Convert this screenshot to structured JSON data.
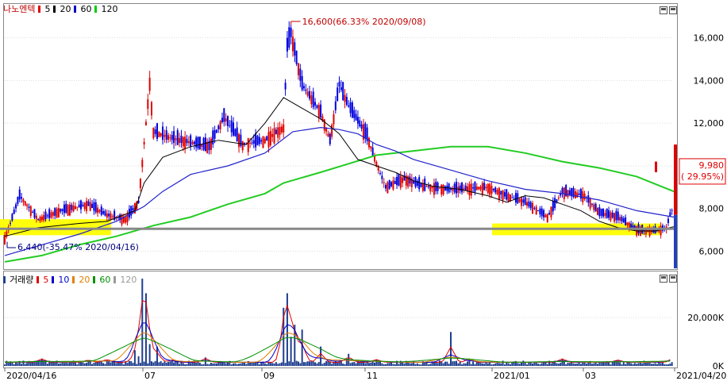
{
  "chart_data": [
    {
      "type": "candlestick",
      "title": "나노엔텍",
      "legend": [
        {
          "name": "5",
          "color": "#e00000"
        },
        {
          "name": "20",
          "color": "#000000"
        },
        {
          "name": "60",
          "color": "#0000cc"
        },
        {
          "name": "120",
          "color": "#00cc00"
        }
      ],
      "ylim": [
        5200,
        17400
      ],
      "yticks": [
        "6,000",
        "8,000",
        "10,000",
        "12,000",
        "14,000",
        "16,000"
      ],
      "xticks": [
        "2020/04/16",
        "07",
        "09",
        "11",
        "2021/01",
        "03",
        "2021/04/20"
      ],
      "last_price": "9,980",
      "last_change": "( 29.95%)",
      "annotation_high": "16,600(66.33% 2020/09/08)",
      "annotation_low": "6,440(-35.47% 2020/04/16)",
      "support_line": 7050,
      "ma": {
        "ma20": [
          [
            0,
            6700
          ],
          [
            18,
            7100
          ],
          [
            40,
            7300
          ],
          [
            55,
            7400
          ],
          [
            70,
            7900
          ],
          [
            75,
            9200
          ],
          [
            85,
            10400
          ],
          [
            100,
            10900
          ],
          [
            115,
            11200
          ],
          [
            130,
            11000
          ],
          [
            140,
            12000
          ],
          [
            150,
            13200
          ],
          [
            160,
            12700
          ],
          [
            170,
            12200
          ],
          [
            180,
            11500
          ],
          [
            190,
            10300
          ],
          [
            200,
            10000
          ],
          [
            210,
            9700
          ],
          [
            220,
            9300
          ],
          [
            230,
            9050
          ],
          [
            245,
            8900
          ],
          [
            260,
            8600
          ],
          [
            270,
            8300
          ],
          [
            280,
            8600
          ],
          [
            290,
            8500
          ],
          [
            300,
            8200
          ],
          [
            310,
            7900
          ],
          [
            320,
            7400
          ],
          [
            330,
            7100
          ],
          [
            340,
            6950
          ],
          [
            350,
            6950
          ],
          [
            360,
            7150
          ]
        ],
        "ma60": [
          [
            0,
            5800
          ],
          [
            20,
            6300
          ],
          [
            40,
            6800
          ],
          [
            60,
            7400
          ],
          [
            75,
            8100
          ],
          [
            85,
            8800
          ],
          [
            100,
            9600
          ],
          [
            120,
            10000
          ],
          [
            140,
            10600
          ],
          [
            155,
            11600
          ],
          [
            170,
            11800
          ],
          [
            180,
            11700
          ],
          [
            190,
            11500
          ],
          [
            200,
            11000
          ],
          [
            210,
            10700
          ],
          [
            220,
            10300
          ],
          [
            240,
            9800
          ],
          [
            260,
            9300
          ],
          [
            280,
            8900
          ],
          [
            300,
            8700
          ],
          [
            320,
            8400
          ],
          [
            340,
            7900
          ],
          [
            360,
            7600
          ]
        ],
        "ma120": [
          [
            0,
            5500
          ],
          [
            20,
            5800
          ],
          [
            40,
            6300
          ],
          [
            60,
            6700
          ],
          [
            80,
            7200
          ],
          [
            100,
            7600
          ],
          [
            120,
            8200
          ],
          [
            140,
            8700
          ],
          [
            150,
            9200
          ],
          [
            170,
            9700
          ],
          [
            185,
            10100
          ],
          [
            200,
            10500
          ],
          [
            220,
            10700
          ],
          [
            240,
            10900
          ],
          [
            260,
            10900
          ],
          [
            280,
            10600
          ],
          [
            300,
            10200
          ],
          [
            320,
            9900
          ],
          [
            340,
            9500
          ],
          [
            360,
            8800
          ]
        ]
      }
    },
    {
      "type": "bar",
      "title": "거래량",
      "legend": [
        {
          "name": "5",
          "color": "#e00000"
        },
        {
          "name": "10",
          "color": "#0000cc"
        },
        {
          "name": "20",
          "color": "#e08000"
        },
        {
          "name": "60",
          "color": "#009000"
        },
        {
          "name": "120",
          "color": "#999999"
        }
      ],
      "ylim": [
        0,
        38000
      ],
      "yticks": [
        "0K",
        "20,000K"
      ],
      "spikes": [
        [
          20,
          3000
        ],
        [
          45,
          2200
        ],
        [
          55,
          2600
        ],
        [
          70,
          6500
        ],
        [
          72,
          4000
        ],
        [
          74,
          36000
        ],
        [
          76,
          30000
        ],
        [
          78,
          9000
        ],
        [
          82,
          8000
        ],
        [
          90,
          2000
        ],
        [
          108,
          3500
        ],
        [
          150,
          24000
        ],
        [
          152,
          30000
        ],
        [
          154,
          12000
        ],
        [
          156,
          17000
        ],
        [
          160,
          15000
        ],
        [
          170,
          8000
        ],
        [
          185,
          5000
        ],
        [
          200,
          2500
        ],
        [
          240,
          14000
        ],
        [
          250,
          3000
        ],
        [
          300,
          3000
        ],
        [
          330,
          2000
        ],
        [
          360,
          4500
        ]
      ]
    }
  ]
}
